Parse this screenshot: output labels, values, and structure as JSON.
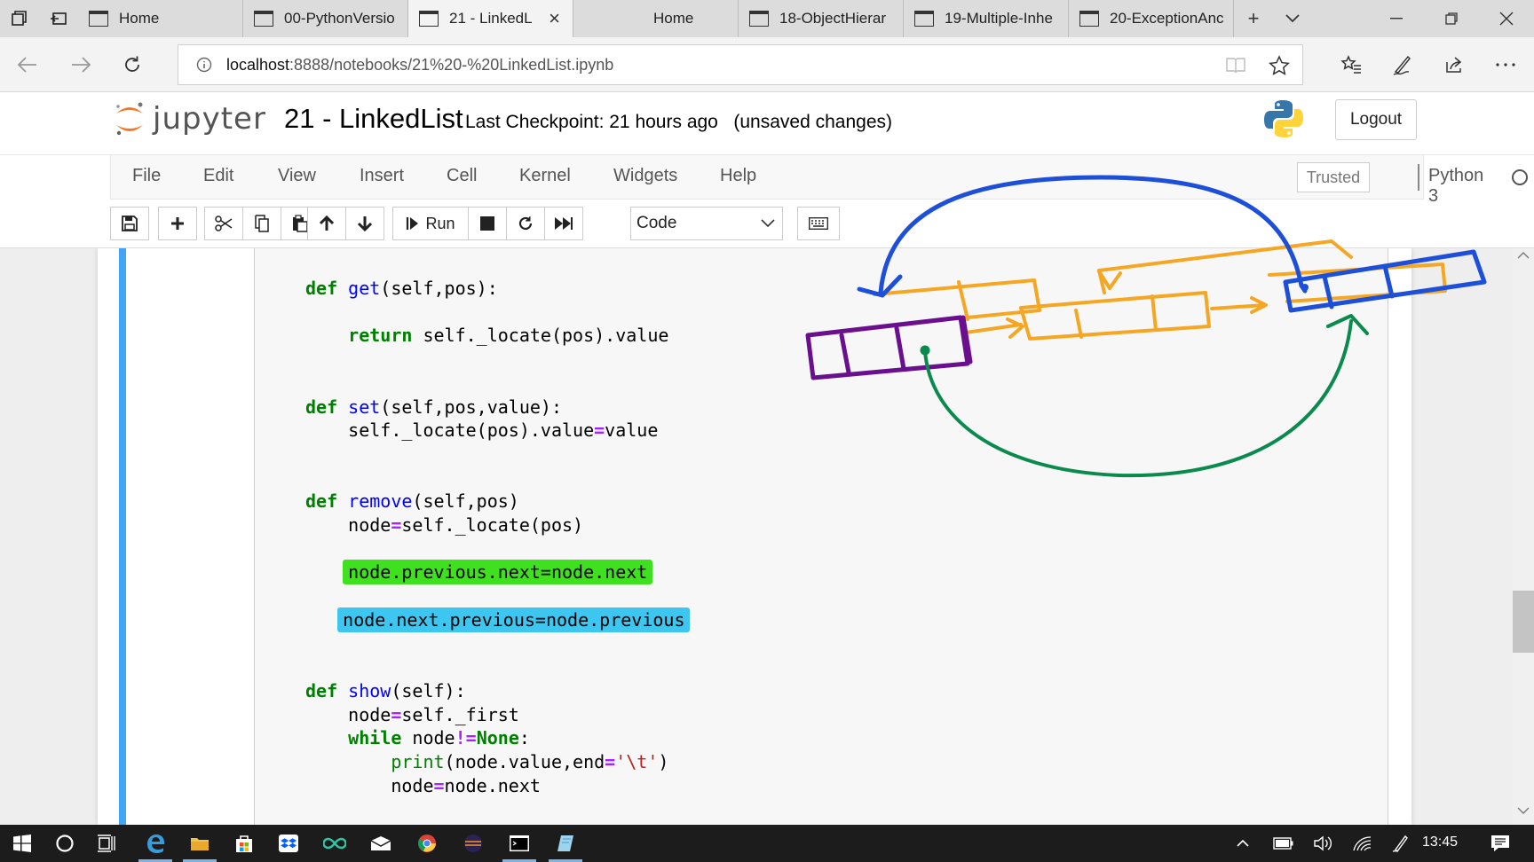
{
  "browser": {
    "tabs": [
      {
        "title": "Home",
        "icon": "page-icon",
        "active": false
      },
      {
        "title": "00-PythonVersio",
        "icon": "page-icon",
        "active": false
      },
      {
        "title": "21 - LinkedL",
        "icon": "page-icon",
        "active": true
      },
      {
        "title": "Home",
        "icon": "none",
        "active": false
      },
      {
        "title": "18-ObjectHierar",
        "icon": "page-icon",
        "active": false
      },
      {
        "title": "19-Multiple-Inhe",
        "icon": "page-icon",
        "active": false
      },
      {
        "title": "20-ExceptionAnc",
        "icon": "page-icon",
        "active": false
      }
    ],
    "url_host": "localhost",
    "url_rest": ":8888/notebooks/21%20-%20LinkedList.ipynb"
  },
  "jupyter": {
    "logo_text": "jupyter",
    "notebook_title": "21 - LinkedList",
    "checkpoint": "Last Checkpoint: 21 hours ago",
    "unsaved": "(unsaved changes)",
    "logout_label": "Logout",
    "menu": [
      "File",
      "Edit",
      "View",
      "Insert",
      "Cell",
      "Kernel",
      "Widgets",
      "Help"
    ],
    "trusted_label": "Trusted",
    "kernel_name": "Python 3",
    "toolbar": {
      "run_label": "Run",
      "cell_type": "Code"
    }
  },
  "code": {
    "def_kw": "def",
    "return_kw": "return",
    "while_kw": "while",
    "get_name": "get",
    "get_args": "(self,pos):",
    "get_return": " self._locate(pos).value",
    "set_name": "set",
    "set_args": "(self,pos,value):",
    "set_body_a": "self._locate(pos).value",
    "set_body_b": "value",
    "remove_name": "remove",
    "remove_args": "(self,pos)",
    "remove_body_a": "node",
    "remove_body_b": "self._locate(pos)",
    "hl_green_line": "node.previous.next=node.next",
    "hl_blue_line": "node.next.previous=node.previous",
    "show_name": "show",
    "show_args": "(self):",
    "show_body_a": "node",
    "show_body_b": "self._first",
    "while_a": " node",
    "while_op": "!=",
    "while_none": "None",
    "while_colon": ":",
    "print_name": "print",
    "print_a": "(node.value,end",
    "print_str": "'\\t'",
    "print_close": ")",
    "node_next_a": "node",
    "node_next_b": "node.next",
    "eq": "="
  },
  "taskbar": {
    "clock": "13:45"
  },
  "ink_colors": {
    "purple": "#6a0f8e",
    "orange": "#f5a623",
    "blue": "#1d4fd8",
    "green": "#0b8a4e"
  }
}
